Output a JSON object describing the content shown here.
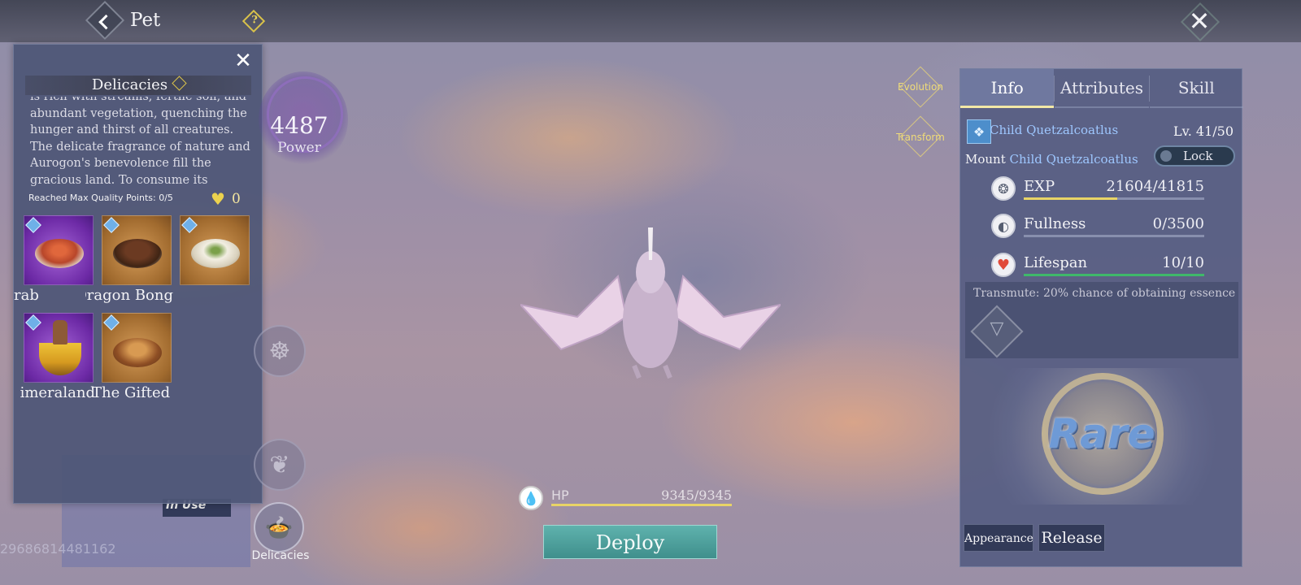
{
  "topbar": {
    "title": "Pet",
    "help_icon": "?",
    "close_icon": "close-icon"
  },
  "delicacies": {
    "title": "Delicacies",
    "description": "is rich with streams, fertile soil, and abundant vegetation, quenching the hunger and thirst of all creatures. The delicate fragrance of nature and Aurogon's benevolence fill the gracious land. To consume its",
    "max_quality_points": "Reached Max Quality Points: 0/5",
    "hearts": "0",
    "items": [
      {
        "label": "rab",
        "rarity": "purple",
        "dish": "red"
      },
      {
        "label": "Dragon Bong",
        "rarity": "gold",
        "dish": "brown"
      },
      {
        "label": "",
        "rarity": "gold",
        "dish": "rice"
      },
      {
        "label": "imeraland",
        "rarity": "purple",
        "dish": "bowl"
      },
      {
        "label": "The Gifted",
        "rarity": "gold",
        "dish": "stew"
      }
    ],
    "button_label": "Delicacies"
  },
  "power": {
    "value": "4487",
    "label": "Power"
  },
  "actions": {
    "evolution": "Evolution",
    "transform": "Transform"
  },
  "status": {
    "in_use": "In Use",
    "pet_id": "29686814481162"
  },
  "hp": {
    "label": "HP",
    "value": "9345/9345",
    "fraction": 1.0
  },
  "deploy_label": "Deploy",
  "info_panel": {
    "tabs": [
      "Info",
      "Attributes",
      "Skill"
    ],
    "active_tab": "Info",
    "pet_name": "Child Quetzalcoatlus",
    "level": "Lv. 41/50",
    "mount_label": "Mount",
    "mount_name": "Child Quetzalcoatlus",
    "lock_label": "Lock",
    "stats": [
      {
        "name": "EXP",
        "value": "21604/41815",
        "fraction": 0.517,
        "color": "#e8d466"
      },
      {
        "name": "Fullness",
        "value": "0/3500",
        "fraction": 0.0,
        "color": "#e8d466"
      },
      {
        "name": "Lifespan",
        "value": "10/10",
        "fraction": 1.0,
        "color": "#3fb86a"
      }
    ],
    "transmute": "Transmute: 20% chance of obtaining essence",
    "rarity": "Rare",
    "appearance_label": "Appearance",
    "release_label": "Release"
  }
}
